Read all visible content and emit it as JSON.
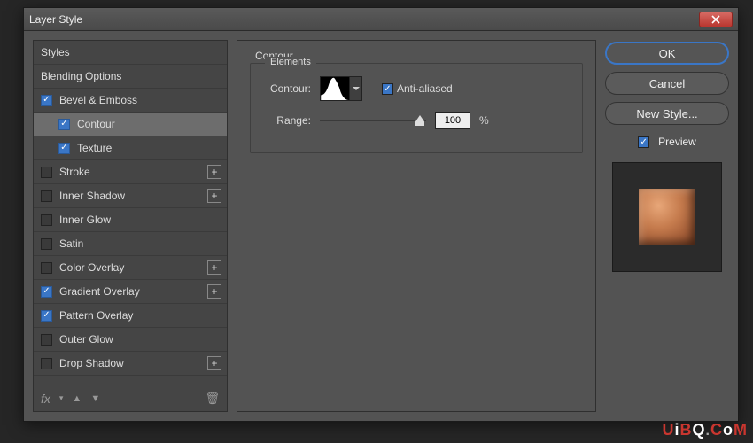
{
  "window": {
    "title": "Layer Style"
  },
  "styles_list": [
    {
      "label": "Styles",
      "cb": null
    },
    {
      "label": "Blending Options",
      "cb": null
    },
    {
      "label": "Bevel & Emboss",
      "cb": true
    },
    {
      "label": "Contour",
      "cb": true,
      "sub": true,
      "selected": true
    },
    {
      "label": "Texture",
      "cb": true,
      "sub": true
    },
    {
      "label": "Stroke",
      "cb": false,
      "add": true
    },
    {
      "label": "Inner Shadow",
      "cb": false,
      "add": true
    },
    {
      "label": "Inner Glow",
      "cb": false
    },
    {
      "label": "Satin",
      "cb": false
    },
    {
      "label": "Color Overlay",
      "cb": false,
      "add": true
    },
    {
      "label": "Gradient Overlay",
      "cb": true,
      "add": true
    },
    {
      "label": "Pattern Overlay",
      "cb": true
    },
    {
      "label": "Outer Glow",
      "cb": false
    },
    {
      "label": "Drop Shadow",
      "cb": false,
      "add": true
    }
  ],
  "footer": {
    "fx": "fx",
    "dd": "▾"
  },
  "center": {
    "title": "Contour",
    "legend": "Elements",
    "contour_label": "Contour:",
    "anti_aliased_label": "Anti-aliased",
    "range_label": "Range:",
    "range_value": "100",
    "range_unit": "%"
  },
  "buttons": {
    "ok": "OK",
    "cancel": "Cancel",
    "new_style": "New Style..."
  },
  "preview_label": "Preview",
  "watermark": "UiBQ.CoM"
}
